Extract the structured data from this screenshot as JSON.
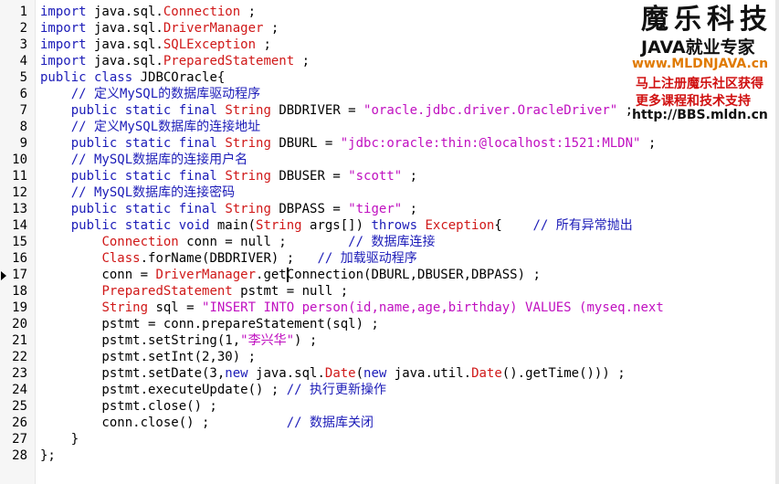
{
  "editor": {
    "lines": [
      {
        "n": "1",
        "segs": [
          [
            "kw",
            "import"
          ],
          [
            "p",
            " java.sql."
          ],
          [
            "ty",
            "Connection"
          ],
          [
            "p",
            " ;"
          ]
        ]
      },
      {
        "n": "2",
        "segs": [
          [
            "kw",
            "import"
          ],
          [
            "p",
            " java.sql."
          ],
          [
            "ty",
            "DriverManager"
          ],
          [
            "p",
            " ;"
          ]
        ]
      },
      {
        "n": "3",
        "segs": [
          [
            "kw",
            "import"
          ],
          [
            "p",
            " java.sql."
          ],
          [
            "ty",
            "SQLException"
          ],
          [
            "p",
            " ;"
          ]
        ]
      },
      {
        "n": "4",
        "segs": [
          [
            "kw",
            "import"
          ],
          [
            "p",
            " java.sql."
          ],
          [
            "ty",
            "PreparedStatement"
          ],
          [
            "p",
            " ;"
          ]
        ]
      },
      {
        "n": "5",
        "segs": [
          [
            "kw",
            "public class"
          ],
          [
            "p",
            " JDBCOracle{"
          ]
        ]
      },
      {
        "n": "6",
        "segs": [
          [
            "p",
            "    "
          ],
          [
            "cm",
            "// 定义MySQL的数据库驱动程序"
          ]
        ]
      },
      {
        "n": "7",
        "segs": [
          [
            "p",
            "    "
          ],
          [
            "kw",
            "public static final"
          ],
          [
            "p",
            " "
          ],
          [
            "ty",
            "String"
          ],
          [
            "p",
            " DBDRIVER = "
          ],
          [
            "str",
            "\"oracle.jdbc.driver.OracleDriver\""
          ],
          [
            "p",
            " ;"
          ]
        ]
      },
      {
        "n": "8",
        "segs": [
          [
            "p",
            "    "
          ],
          [
            "cm",
            "// 定义MySQL数据库的连接地址"
          ]
        ]
      },
      {
        "n": "9",
        "segs": [
          [
            "p",
            "    "
          ],
          [
            "kw",
            "public static final"
          ],
          [
            "p",
            " "
          ],
          [
            "ty",
            "String"
          ],
          [
            "p",
            " DBURL = "
          ],
          [
            "str",
            "\"jdbc:oracle:thin:@localhost:1521:MLDN\""
          ],
          [
            "p",
            " ;"
          ]
        ]
      },
      {
        "n": "10",
        "segs": [
          [
            "p",
            "    "
          ],
          [
            "cm",
            "// MySQL数据库的连接用户名"
          ]
        ]
      },
      {
        "n": "11",
        "segs": [
          [
            "p",
            "    "
          ],
          [
            "kw",
            "public static final"
          ],
          [
            "p",
            " "
          ],
          [
            "ty",
            "String"
          ],
          [
            "p",
            " DBUSER = "
          ],
          [
            "str",
            "\"scott\""
          ],
          [
            "p",
            " ;"
          ]
        ]
      },
      {
        "n": "12",
        "segs": [
          [
            "p",
            "    "
          ],
          [
            "cm",
            "// MySQL数据库的连接密码"
          ]
        ]
      },
      {
        "n": "13",
        "segs": [
          [
            "p",
            "    "
          ],
          [
            "kw",
            "public static final"
          ],
          [
            "p",
            " "
          ],
          [
            "ty",
            "String"
          ],
          [
            "p",
            " DBPASS = "
          ],
          [
            "str",
            "\"tiger\""
          ],
          [
            "p",
            " ;"
          ]
        ]
      },
      {
        "n": "14",
        "segs": [
          [
            "p",
            "    "
          ],
          [
            "kw",
            "public static void"
          ],
          [
            "p",
            " main("
          ],
          [
            "ty",
            "String"
          ],
          [
            "p",
            " args[]) "
          ],
          [
            "kw",
            "throws"
          ],
          [
            "p",
            " "
          ],
          [
            "ty",
            "Exception"
          ],
          [
            "p",
            "{    "
          ],
          [
            "cm",
            "// 所有异常抛出"
          ]
        ]
      },
      {
        "n": "15",
        "segs": [
          [
            "p",
            "        "
          ],
          [
            "ty",
            "Connection"
          ],
          [
            "p",
            " conn = null ;        "
          ],
          [
            "cm",
            "// 数据库连接"
          ]
        ]
      },
      {
        "n": "16",
        "segs": [
          [
            "p",
            "        "
          ],
          [
            "ty",
            "Class"
          ],
          [
            "p",
            ".forName(DBDRIVER) ;   "
          ],
          [
            "cm",
            "// 加载驱动程序"
          ]
        ]
      },
      {
        "n": "17",
        "segs": [
          [
            "p",
            "        conn = "
          ],
          [
            "ty",
            "DriverManager"
          ],
          [
            "p",
            ".getConnection(DBURL,DBUSER,DBPASS) ;"
          ]
        ]
      },
      {
        "n": "18",
        "segs": [
          [
            "p",
            "        "
          ],
          [
            "ty",
            "PreparedStatement"
          ],
          [
            "p",
            " pstmt = null ;"
          ]
        ]
      },
      {
        "n": "19",
        "segs": [
          [
            "p",
            "        "
          ],
          [
            "ty",
            "String"
          ],
          [
            "p",
            " sql = "
          ],
          [
            "str",
            "\"INSERT INTO person(id,name,age,birthday) VALUES (myseq.next"
          ]
        ]
      },
      {
        "n": "20",
        "segs": [
          [
            "p",
            "        pstmt = conn.prepareStatement(sql) ;"
          ]
        ]
      },
      {
        "n": "21",
        "segs": [
          [
            "p",
            "        pstmt.setString(1,"
          ],
          [
            "str",
            "\"李兴华\""
          ],
          [
            "p",
            ") ;"
          ]
        ]
      },
      {
        "n": "22",
        "segs": [
          [
            "p",
            "        pstmt.setInt(2,30) ;"
          ]
        ]
      },
      {
        "n": "23",
        "segs": [
          [
            "p",
            "        pstmt.setDate(3,"
          ],
          [
            "kw",
            "new"
          ],
          [
            "p",
            " java.sql."
          ],
          [
            "ty",
            "Date"
          ],
          [
            "p",
            "("
          ],
          [
            "kw",
            "new"
          ],
          [
            "p",
            " java.util."
          ],
          [
            "ty",
            "Date"
          ],
          [
            "p",
            "().getTime())) ;"
          ]
        ]
      },
      {
        "n": "24",
        "segs": [
          [
            "p",
            "        pstmt.executeUpdate() ; "
          ],
          [
            "cm",
            "// 执行更新操作"
          ]
        ]
      },
      {
        "n": "25",
        "segs": [
          [
            "p",
            "        pstmt.close() ;"
          ]
        ]
      },
      {
        "n": "26",
        "segs": [
          [
            "p",
            "        conn.close() ;          "
          ],
          [
            "cm",
            "// 数据库关闭"
          ]
        ]
      },
      {
        "n": "27",
        "segs": [
          [
            "p",
            "    }"
          ]
        ]
      },
      {
        "n": "28",
        "segs": [
          [
            "p",
            "};"
          ]
        ]
      }
    ],
    "marker_line": "17"
  },
  "watermark": {
    "title": "魔乐科技",
    "subtitle": "JAVA就业专家",
    "url": "www.MLDNJAVA.cn",
    "promo1": "马上注册魔乐社区获得",
    "promo2": "更多课程和技术支持",
    "bbs": "http://BBS.mldn.cn"
  }
}
